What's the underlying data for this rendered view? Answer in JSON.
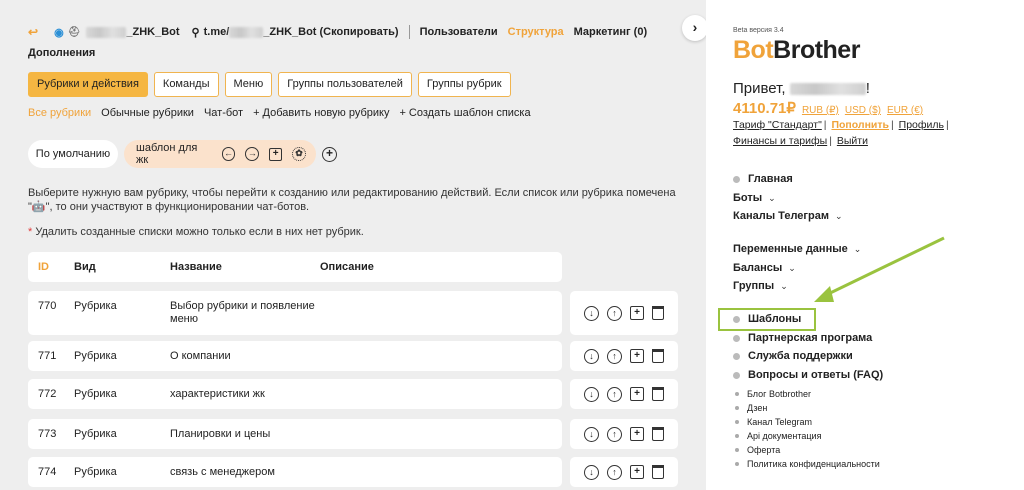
{
  "topnav": {
    "back_icon": "back-arrow-icon",
    "bot_name": "_ZHK_Bot",
    "link_prefix": "t.me/",
    "link_suffix": "_ZHK_Bot (Скопировать)",
    "items": [
      "Пользователи",
      "Структура",
      "Маркетинг (0)"
    ],
    "second_line": "Дополнения"
  },
  "tabs": [
    "Рубрики и действия",
    "Команды",
    "Меню",
    "Группы пользователей",
    "Группы рубрик"
  ],
  "subtabs": [
    "Все рубрики",
    "Обычные рубрики",
    "Чат-бот",
    "+ Добавить новую рубрику",
    "+ Создать шаблон списка"
  ],
  "lists": {
    "default": "По умолчанию",
    "template": "шаблон для жк"
  },
  "info_text": "Выберите нужную вам рубрику, чтобы перейти к созданию или редактированию действий. Если список или рубрика помечена \"🤖\", то они участвуют в функционировании чат-ботов.",
  "note": {
    "star": "*",
    "text": " Удалить созданные списки можно только если в них нет рубрик."
  },
  "table": {
    "headers": {
      "id": "ID",
      "type": "Вид",
      "name": "Название",
      "desc": "Описание"
    },
    "rows": [
      {
        "id": "770",
        "type": "Рубрика",
        "name": "Выбор рубрики и появление меню",
        "desc": ""
      },
      {
        "id": "771",
        "type": "Рубрика",
        "name": "О компании",
        "desc": ""
      },
      {
        "id": "772",
        "type": "Рубрика",
        "name": "характеристики жк",
        "desc": ""
      },
      {
        "id": "773",
        "type": "Рубрика",
        "name": "Планировки и цены",
        "desc": ""
      },
      {
        "id": "774",
        "type": "Рубрика",
        "name": "связь с менеджером",
        "desc": ""
      }
    ]
  },
  "sidebar": {
    "beta": "Beta версия 3.4",
    "logo_part1": "Bot",
    "logo_part2": "Brother",
    "greeting_prefix": "Привет,",
    "greeting_suffix": "!",
    "balance": "4110.71₽",
    "currencies": [
      "RUB (₽)",
      "USD ($)",
      "EUR (€)"
    ],
    "links": [
      "Тариф \"Стандарт\"",
      "Пополнить",
      "Профиль",
      "Финансы и тарифы",
      "Выйти"
    ],
    "menu1": [
      "Главная",
      "Боты",
      "Каналы Телеграм"
    ],
    "menu2": [
      "Переменные данные",
      "Балансы",
      "Группы"
    ],
    "menu3": [
      "Шаблоны",
      "Партнерская програма",
      "Служба поддержки",
      "Вопросы и ответы (FAQ)"
    ],
    "small_links": [
      "Блог Botbrother",
      "Дзен",
      "Канал Telegram",
      "Api документация",
      "Оферта",
      "Политика конфиденциальности"
    ]
  },
  "colors": {
    "accent": "#f0a33a",
    "highlight": "#9ac33f",
    "bg": "#eeeeee"
  }
}
